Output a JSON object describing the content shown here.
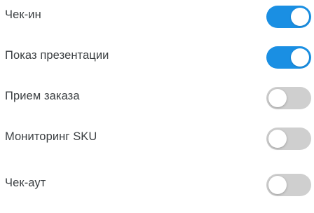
{
  "settings": [
    {
      "label": "Чек-ин",
      "enabled": true
    },
    {
      "label": "Показ презентации",
      "enabled": true
    },
    {
      "label": "Прием заказа",
      "enabled": false
    },
    {
      "label": "Мониторинг SKU",
      "enabled": false
    },
    {
      "label": "Чек-аут",
      "enabled": false
    }
  ],
  "colors": {
    "toggle_on": "#1a8fe3",
    "toggle_off": "#cfcfcf",
    "label_text": "#3c4043"
  }
}
